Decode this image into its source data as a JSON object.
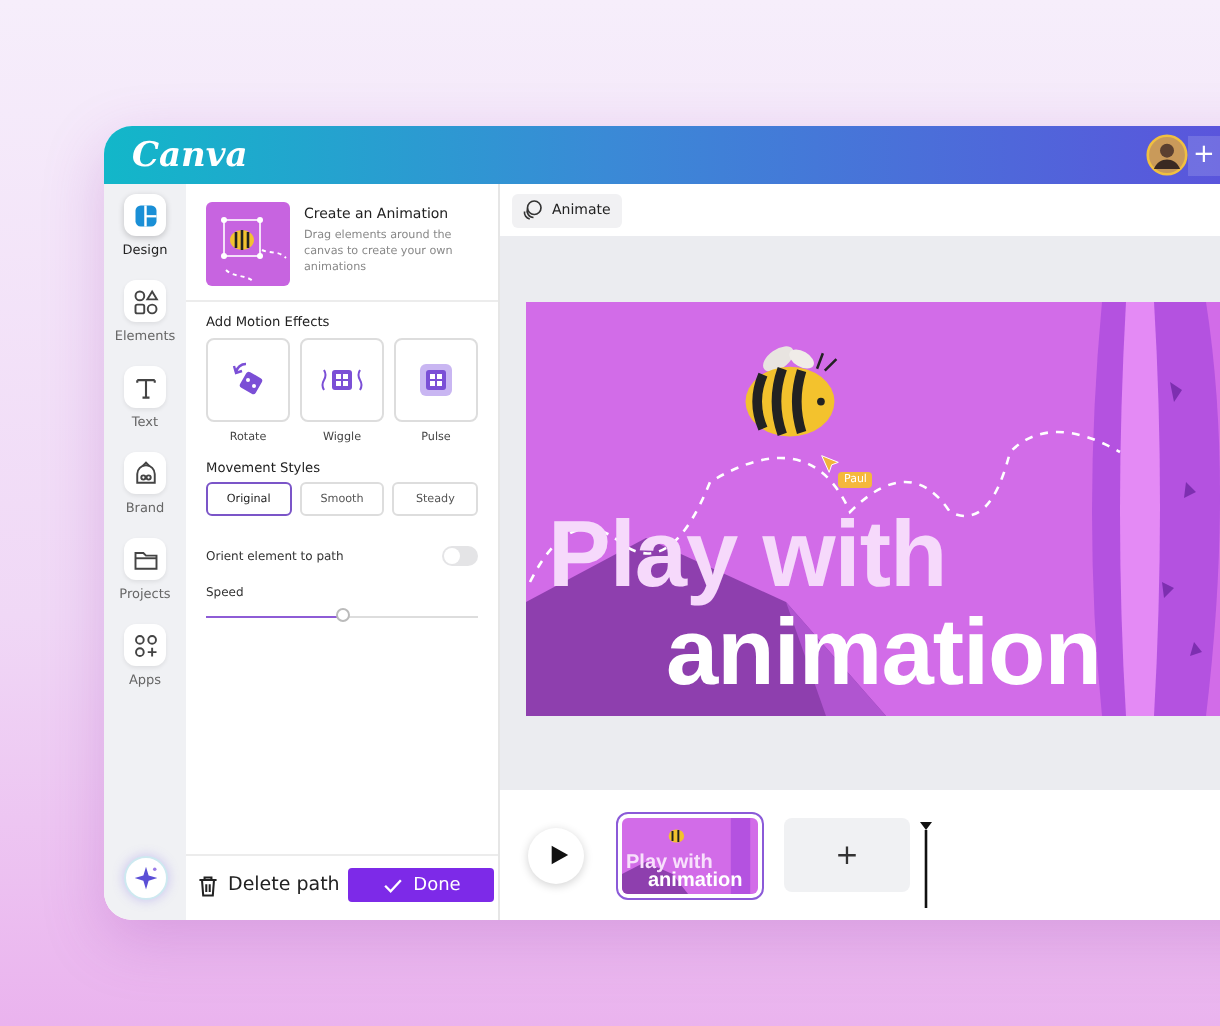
{
  "top_bar": {
    "logo": "Canva",
    "add_button": "+"
  },
  "rail": [
    {
      "label": "Design",
      "selected": true,
      "kind": "design"
    },
    {
      "label": "Elements",
      "selected": false,
      "kind": "elements"
    },
    {
      "label": "Text",
      "selected": false,
      "kind": "text"
    },
    {
      "label": "Brand",
      "selected": false,
      "kind": "brand"
    },
    {
      "label": "Projects",
      "selected": false,
      "kind": "projects"
    },
    {
      "label": "Apps",
      "selected": false,
      "kind": "apps"
    }
  ],
  "panel": {
    "title": "Create an Animation",
    "description": "Drag elements around the canvas to create your own animations",
    "motion_heading": "Add Motion Effects",
    "effects": [
      {
        "label": "Rotate",
        "kind": "rotate"
      },
      {
        "label": "Wiggle",
        "kind": "wiggle"
      },
      {
        "label": "Pulse",
        "kind": "pulse"
      }
    ],
    "styles_heading": "Movement Styles",
    "styles": [
      {
        "label": "Original",
        "selected": true
      },
      {
        "label": "Smooth",
        "selected": false
      },
      {
        "label": "Steady",
        "selected": false
      }
    ],
    "orient": {
      "label": "Orient element to path",
      "on": false
    },
    "speed": {
      "label": "Speed",
      "level": 0.5
    },
    "delete_label": "Delete path",
    "done_label": "Done"
  },
  "toolbar": {
    "animate_label": "Animate"
  },
  "design": {
    "line_1": "Play with",
    "line_2": "animation",
    "cursor_label": "Paul"
  },
  "timeline": {
    "pages": [
      {
        "line_1": "Play with",
        "line_2": "animation",
        "selected": true
      }
    ],
    "add_label": "+"
  }
}
